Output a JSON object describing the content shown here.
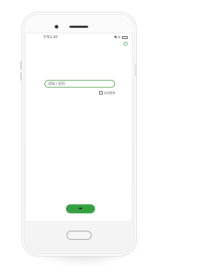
{
  "status_bar": {
    "time": "下午1:47",
    "icons": [
      "signal-icon",
      "wifi-icon",
      "battery-icon"
    ],
    "signal_glyph": "◥",
    "wifi_glyph": "≋"
  },
  "login": {
    "input_placeholder": "请输入密码",
    "remember_label": "自动登录",
    "submit_icon": "arrow-right-icon",
    "submit_glyph": "➡"
  },
  "colors": {
    "accent": "#35a041",
    "input_border": "#5aa85a",
    "background": "#ffffff"
  }
}
